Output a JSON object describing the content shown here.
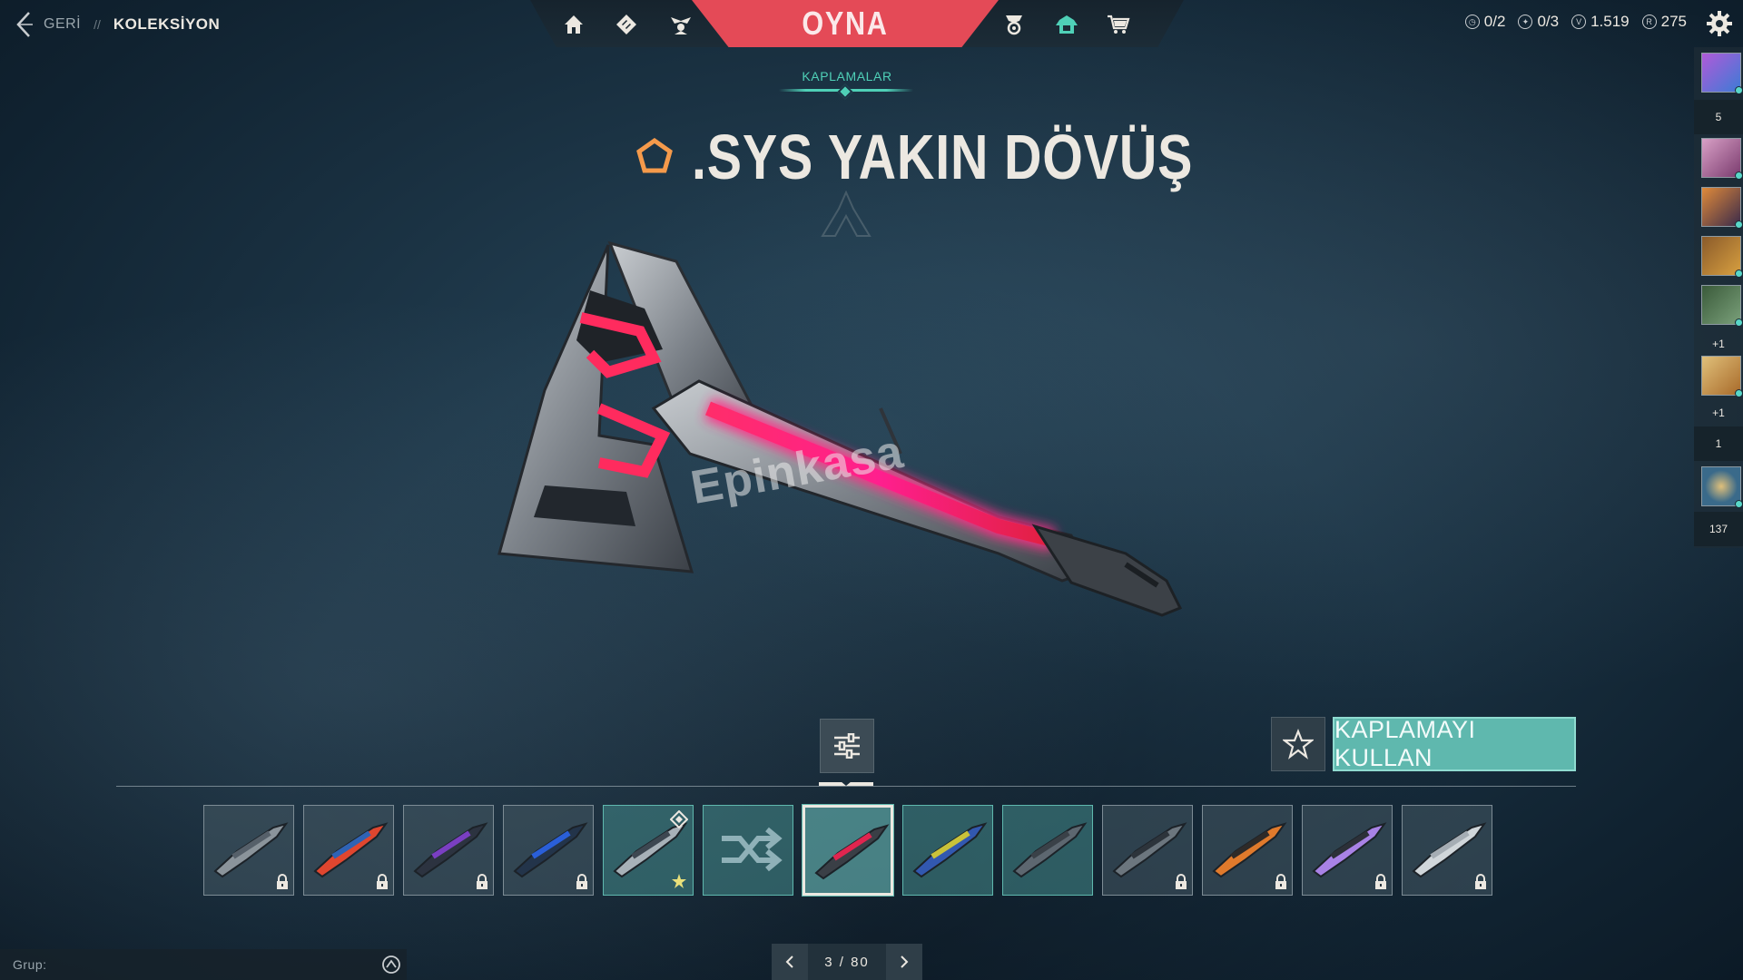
{
  "header": {
    "back_label": "GERİ",
    "separator": "//",
    "current": "KOLEKSİYON",
    "play_label": "OYNA"
  },
  "nav": {
    "icons": [
      "home-icon",
      "career-icon",
      "agents-icon",
      "battlepass-icon",
      "collection-icon",
      "store-icon"
    ],
    "active": "collection-icon"
  },
  "stats": {
    "missions": "0/2",
    "weekly": "0/3",
    "valorant_points": "1.519",
    "radianite_points": "275"
  },
  "section_tab": "KAPLAMALAR",
  "item": {
    "name": ".SYS YAKIN DÖVÜŞ",
    "tier_color": "#f59a4b",
    "watermark": "Epinkasa"
  },
  "actions": {
    "equip_label": "KAPLAMAYI KULLAN"
  },
  "skins": [
    {
      "name": "skin-1",
      "locked": true,
      "owned": false,
      "selected": false,
      "colors": [
        "#56606a",
        "#8b949b"
      ]
    },
    {
      "name": "skin-2",
      "locked": true,
      "owned": false,
      "selected": false,
      "colors": [
        "#2f63b5",
        "#e0462f"
      ]
    },
    {
      "name": "skin-3",
      "locked": true,
      "owned": false,
      "selected": false,
      "colors": [
        "#7a3fc2",
        "#2c3340"
      ]
    },
    {
      "name": "skin-4",
      "locked": true,
      "owned": false,
      "selected": false,
      "colors": [
        "#2a5fd8",
        "#23344a"
      ]
    },
    {
      "name": "skin-5",
      "locked": false,
      "owned": true,
      "selected": false,
      "favorite": true,
      "badge": true,
      "colors": [
        "#3d4751",
        "#a7b1b8"
      ]
    },
    {
      "name": "skin-6",
      "locked": false,
      "owned": true,
      "selected": false,
      "random": true,
      "colors": [
        "#8fb1b8",
        "#8fb1b8"
      ]
    },
    {
      "name": "skin-7",
      "locked": false,
      "owned": true,
      "selected": true,
      "colors": [
        "#e0254f",
        "#3a3f46"
      ]
    },
    {
      "name": "skin-8",
      "locked": false,
      "owned": true,
      "selected": false,
      "colors": [
        "#c9c23a",
        "#3258b0"
      ]
    },
    {
      "name": "skin-9",
      "locked": false,
      "owned": true,
      "selected": false,
      "colors": [
        "#3a4148",
        "#5d6770"
      ]
    },
    {
      "name": "skin-10",
      "locked": true,
      "owned": false,
      "selected": false,
      "colors": [
        "#2d343b",
        "#6c767e"
      ]
    },
    {
      "name": "skin-11",
      "locked": true,
      "owned": false,
      "selected": false,
      "colors": [
        "#2e2a28",
        "#e07a2c"
      ]
    },
    {
      "name": "skin-12",
      "locked": true,
      "owned": false,
      "selected": false,
      "colors": [
        "#2c3038",
        "#a982e6"
      ]
    },
    {
      "name": "skin-13",
      "locked": true,
      "owned": false,
      "selected": false,
      "colors": [
        "#a5adb4",
        "#d0d6da"
      ]
    }
  ],
  "group": {
    "label": "Grup:",
    "placeholder": ""
  },
  "pager": {
    "text": "3 / 80"
  },
  "social": {
    "counts": [
      "5",
      "+1",
      "+1",
      "1",
      "137"
    ]
  }
}
